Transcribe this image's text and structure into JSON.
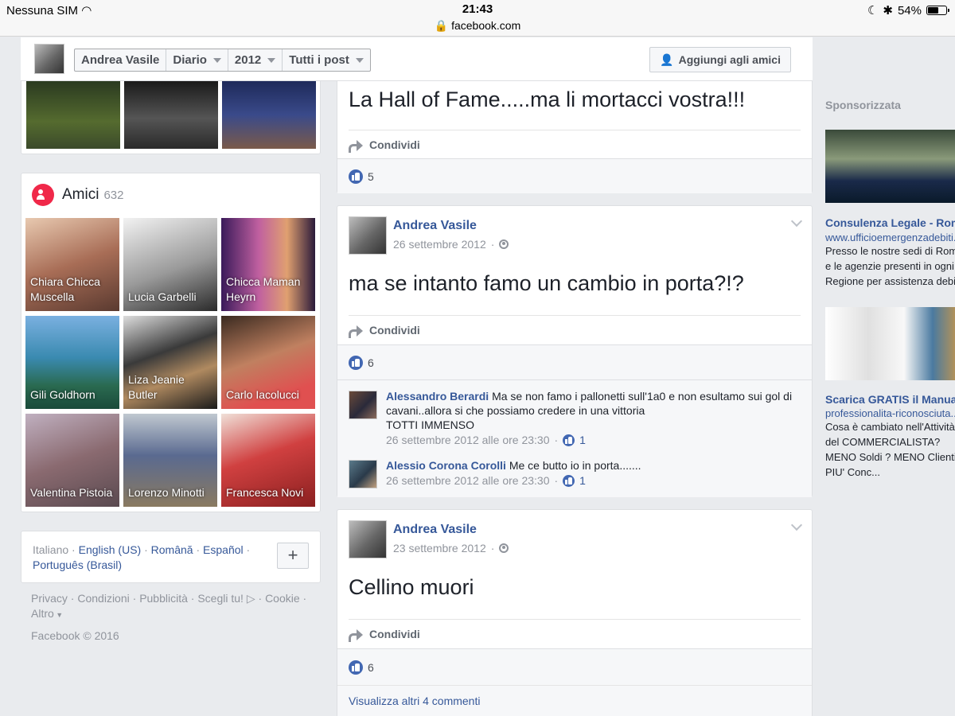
{
  "status_bar": {
    "carrier": "Nessuna SIM",
    "time": "21:43",
    "url": "facebook.com",
    "battery": "54%",
    "battery_level": 0.54
  },
  "nav": {
    "name": "Andrea Vasile",
    "diario": "Diario",
    "year": "2012",
    "filter": "Tutti i post",
    "add_friend": "Aggiungi agli amici"
  },
  "friends": {
    "title": "Amici",
    "count": "632",
    "list": [
      {
        "name": "Chiara Chicca Muscella"
      },
      {
        "name": "Lucia Garbelli"
      },
      {
        "name": "Chicca Maman Heyrn"
      },
      {
        "name": "Gili Goldhorn"
      },
      {
        "name": "Liza Jeanie Butler"
      },
      {
        "name": "Carlo Iacolucci"
      },
      {
        "name": "Valentina Pistoia"
      },
      {
        "name": "Lorenzo Minotti"
      },
      {
        "name": "Francesca Novi"
      }
    ]
  },
  "languages": {
    "current": "Italiano",
    "sep": " · ",
    "english": "English (US)",
    "romana": "Română",
    "espanol": "Español",
    "portugues": "Português (Brasil)",
    "more": "+"
  },
  "footer": {
    "privacy": "Privacy",
    "conditions": "Condizioni",
    "ads": "Pubblicità",
    "adchoices": "Scegli tu!",
    "cookie": "Cookie",
    "more": "Altro",
    "copyright": "Facebook © 2016"
  },
  "posts": [
    {
      "text": "La Hall of Fame.....ma li mortacci vostra!!!",
      "share": "Condividi",
      "likes": "5"
    },
    {
      "author": "Andrea Vasile",
      "date": "26 settembre 2012",
      "text": "ma se intanto famo un cambio in porta?!?",
      "share": "Condividi",
      "likes": "6",
      "comments": [
        {
          "name": "Alessandro Berardi",
          "text": "Ma se non famo i pallonetti sull'1a0 e non esultamo sui gol di cavani..allora si che possiamo credere in una vittoria",
          "text2": "TOTTI IMMENSO",
          "time": "26 settembre 2012 alle ore 23:30",
          "likes": "1"
        },
        {
          "name": "Alessio Corona Corolli",
          "text": "Me ce butto io in porta.......",
          "time": "26 settembre 2012 alle ore 23:30",
          "likes": "1"
        }
      ]
    },
    {
      "author": "Andrea Vasile",
      "date": "23 settembre 2012",
      "text": "Cellino muori",
      "share": "Condividi",
      "likes": "6",
      "more_comments": "Visualizza altri 4 commenti"
    }
  ],
  "sponsored": {
    "label": "Sponsorizzata",
    "ads": [
      {
        "title": "Consulenza Legale - Roma",
        "url": "www.ufficioemergenzadebiti.",
        "line1": "Presso le nostre sedi di Roma",
        "line2": "e le agenzie presenti in ogni",
        "line3": "Regione per assistenza debiti"
      },
      {
        "title": "Scarica GRATIS il Manuale",
        "url": "professionalita-riconosciuta...",
        "line1": "Cosa è cambiato nell'Attività",
        "line2": "del COMMERCIALISTA?",
        "line3": "MENO Soldi ? MENO Clienti",
        "line4": "PIU' Conc..."
      }
    ]
  }
}
